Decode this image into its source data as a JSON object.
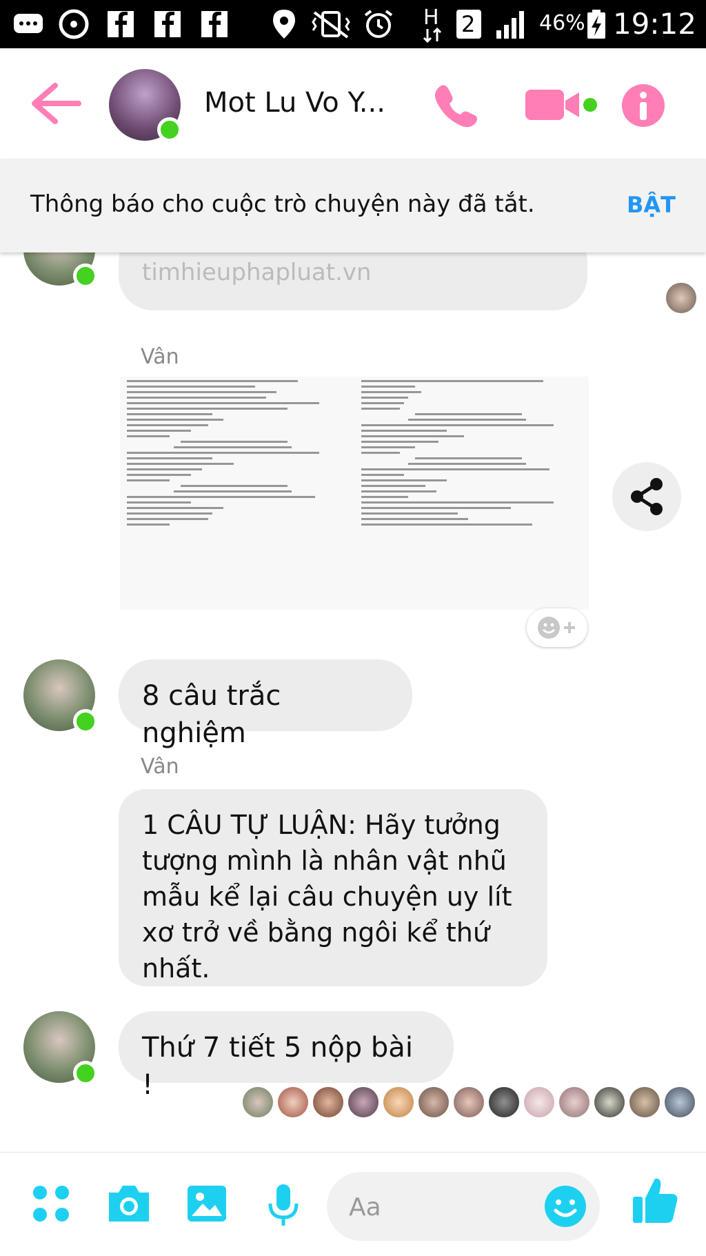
{
  "status_bar": {
    "battery": "46%",
    "clock": "19:12",
    "sim_badge": "2",
    "network": "H"
  },
  "header": {
    "title": "Mot Lu Vo Y...",
    "icons": [
      "back-arrow-icon",
      "phone-icon",
      "video-camera-icon",
      "info-icon"
    ],
    "accent_color": "#ff7eb6"
  },
  "banner": {
    "text": "Thông báo cho cuộc trò chuyện này đã tắt.",
    "button": "BẬT"
  },
  "messages": [
    {
      "type": "link-fragment",
      "text": "timhieuphapluat.vn"
    },
    {
      "sender": "Vân",
      "type": "image"
    },
    {
      "type": "text",
      "text": "8 câu trắc nghiệm"
    },
    {
      "sender": "Vân",
      "type": "text",
      "text": "1 CÂU TỰ LUẬN: Hãy tưởng tượng mình là nhân vật nhũ mẫu kể lại câu chuyện uy lít xơ trở về bằng ngôi kể thứ nhất."
    },
    {
      "type": "text",
      "text": "Thứ 7 tiết 5 nộp bài !"
    }
  ],
  "composer": {
    "placeholder": "Aa",
    "icons": [
      "apps-icon",
      "camera-icon",
      "image-icon",
      "microphone-icon",
      "smiley-icon",
      "thumbs-up-icon"
    ],
    "accent_color": "#1ed0f0"
  }
}
